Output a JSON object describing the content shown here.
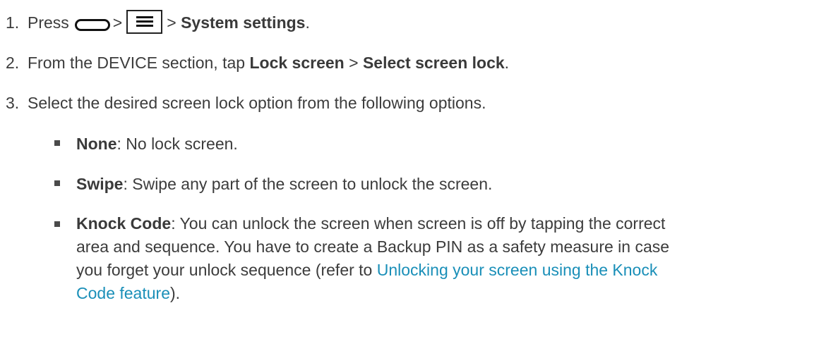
{
  "steps": [
    {
      "num": "1.",
      "prefix": "Press",
      "sep1": ">",
      "sep2": ">",
      "bold1": "System settings",
      "end": "."
    },
    {
      "num": "2.",
      "prefix": "From the DEVICE section, tap",
      "bold1": "Lock screen",
      "sep": ">",
      "bold2": "Select screen lock",
      "end": "."
    },
    {
      "num": "3.",
      "text": "Select the desired screen lock option from the following options."
    }
  ],
  "options": [
    {
      "name": "None",
      "desc": ": No lock screen."
    },
    {
      "name": "Swipe",
      "desc": ": Swipe any part of the screen to unlock the screen."
    },
    {
      "name": "Knock Code",
      "desc_line1": ": You can unlock the screen when screen is off by tapping the correct",
      "desc_line2": "area and sequence. You have to create a Backup PIN as a safety measure in case",
      "desc_line3_prefix": "you forget your unlock sequence (refer to",
      "link_part1": "Unlocking your screen using the Knock",
      "link_part2": "Code feature",
      "desc_end": ")."
    }
  ],
  "icons": {
    "home": "home-key-icon",
    "menu": "menu-key-icon"
  },
  "colors": {
    "text": "#3c3c3c",
    "link": "#1a8fb8"
  }
}
